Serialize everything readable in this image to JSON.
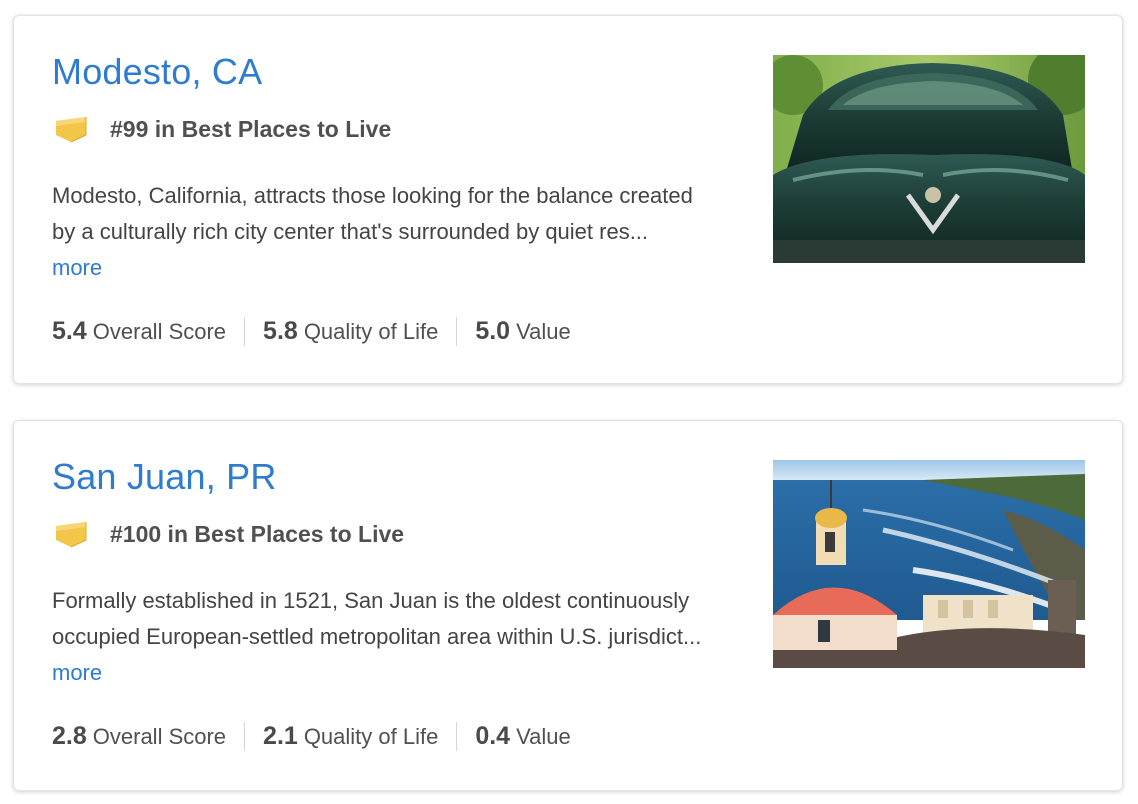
{
  "listings": [
    {
      "city": "Modesto, CA",
      "badge_icon": "ranking-badge-icon",
      "rank": "#99 in Best Places to Live",
      "description": "Modesto, California, attracts those looking for the balance created by a culturally rich city center that's surrounded by quiet res...",
      "more_label": "more",
      "image": "vintage-car-photo",
      "scores": [
        {
          "value": "5.4",
          "label": "Overall Score"
        },
        {
          "value": "5.8",
          "label": "Quality of Life"
        },
        {
          "value": "5.0",
          "label": "Value"
        }
      ]
    },
    {
      "city": "San Juan, PR",
      "badge_icon": "ranking-badge-icon",
      "rank": "#100 in Best Places to Live",
      "description": "Formally established in 1521, San Juan is the oldest continuously occupied European-settled metropolitan area within U.S. jurisdict...",
      "more_label": "more",
      "image": "coastal-dome-photo",
      "scores": [
        {
          "value": "2.8",
          "label": "Overall Score"
        },
        {
          "value": "2.1",
          "label": "Quality of Life"
        },
        {
          "value": "0.4",
          "label": "Value"
        }
      ]
    }
  ],
  "colors": {
    "link": "#2f7ccf",
    "badge": "#f3c64a",
    "text": "#444444"
  }
}
